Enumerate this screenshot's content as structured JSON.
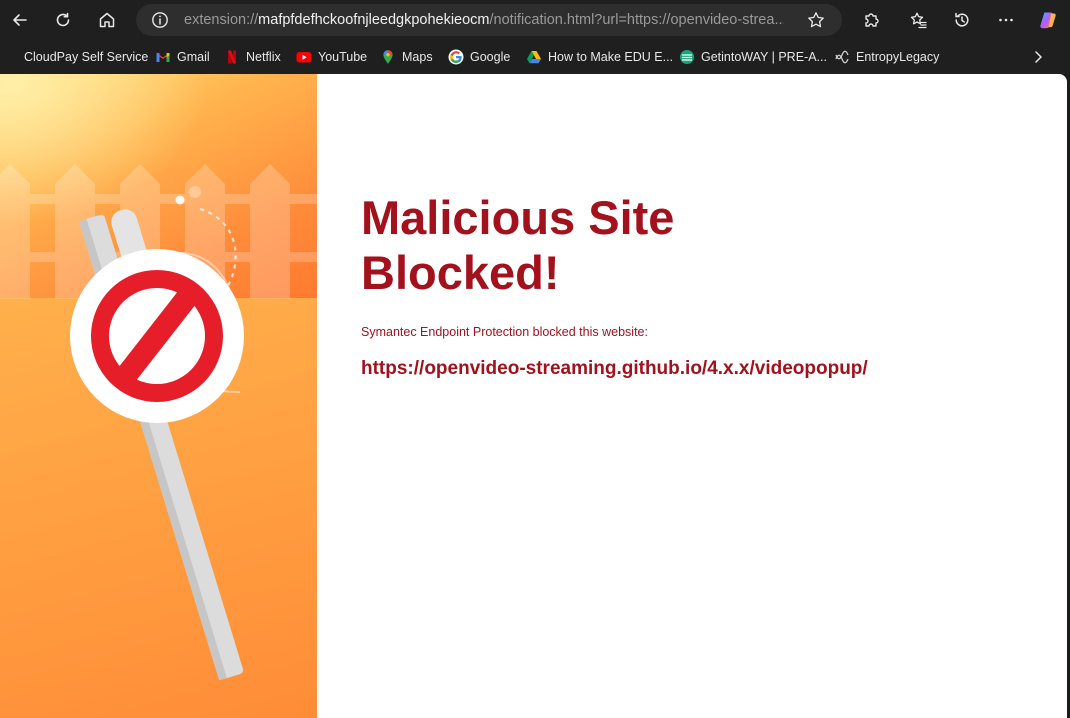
{
  "browser": {
    "address": {
      "scheme": "extension://",
      "host": "mafpfdefhckoofnjleedgkpohekieocm",
      "rest": "/notification.html?url=https://openvideo-strea..."
    },
    "bookmarks": [
      {
        "label": "CloudPay Self Service",
        "icon": "cloudpay-icon"
      },
      {
        "label": "Gmail",
        "icon": "gmail-icon"
      },
      {
        "label": "Netflix",
        "icon": "netflix-icon"
      },
      {
        "label": "YouTube",
        "icon": "youtube-icon"
      },
      {
        "label": "Maps",
        "icon": "maps-icon"
      },
      {
        "label": "Google",
        "icon": "google-icon"
      },
      {
        "label": "How to Make EDU E...",
        "icon": "drive-icon"
      },
      {
        "label": "GetintoWAY | PRE-A...",
        "icon": "getintoway-icon"
      },
      {
        "label": "EntropyLegacy",
        "icon": "entropy-icon"
      }
    ]
  },
  "page": {
    "title_line1": "Malicious Site",
    "title_line2": "Blocked!",
    "subtitle": "Symantec Endpoint Protection blocked this website:",
    "blocked_url": "https://openvideo-streaming.github.io/4.x.x/videopopup/"
  },
  "colors": {
    "accent": "#a3121c",
    "sign_red": "#e61e2a",
    "hero_orange": "#ff8a3a"
  }
}
